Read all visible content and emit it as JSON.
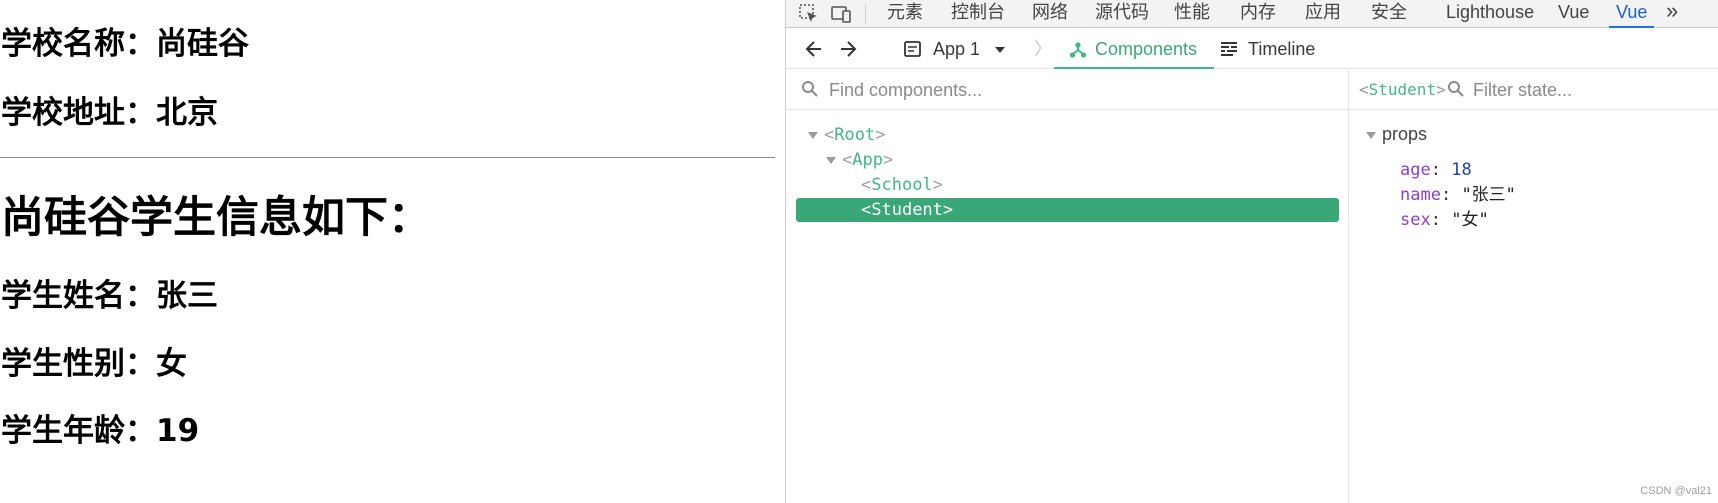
{
  "page": {
    "school_name": "学校名称：尚硅谷",
    "school_address": "学校地址：北京",
    "student_heading": "尚硅谷学生信息如下：",
    "student_name": "学生姓名：张三",
    "student_gender": "学生性别：女",
    "student_age": "学生年龄：19"
  },
  "devtools": {
    "tabs": [
      "元素",
      "控制台",
      "网络",
      "源代码",
      "性能",
      "内存",
      "应用",
      "安全",
      "Lighthouse",
      "Vue",
      "Vue"
    ],
    "more_label": "»",
    "active_tab_index": 10
  },
  "vue_toolbar": {
    "app_select": "App 1",
    "components_label": "Components",
    "timeline_label": "Timeline"
  },
  "component_tree": {
    "search_placeholder": "Find components...",
    "nodes": [
      {
        "name": "Root",
        "level": 0,
        "expanded": true
      },
      {
        "name": "App",
        "level": 1,
        "expanded": true
      },
      {
        "name": "School",
        "level": 2
      },
      {
        "name": "Student",
        "level": 2,
        "selected": true
      }
    ]
  },
  "state_panel": {
    "selected_component": "Student",
    "filter_placeholder": "Filter state...",
    "section_label": "props",
    "props": [
      {
        "key": "age",
        "value": "18",
        "kind": "number"
      },
      {
        "key": "name",
        "value": "\"张三\"",
        "kind": "string"
      },
      {
        "key": "sex",
        "value": "\"女\"",
        "kind": "string"
      }
    ]
  },
  "watermark": "CSDN @val21",
  "colors": {
    "vue_green": "#42b883",
    "selected_bg": "#3aa876",
    "active_tab_blue": "#1a73e8",
    "prop_key": "#8b3fcf",
    "prop_number": "#1a3fbf"
  }
}
